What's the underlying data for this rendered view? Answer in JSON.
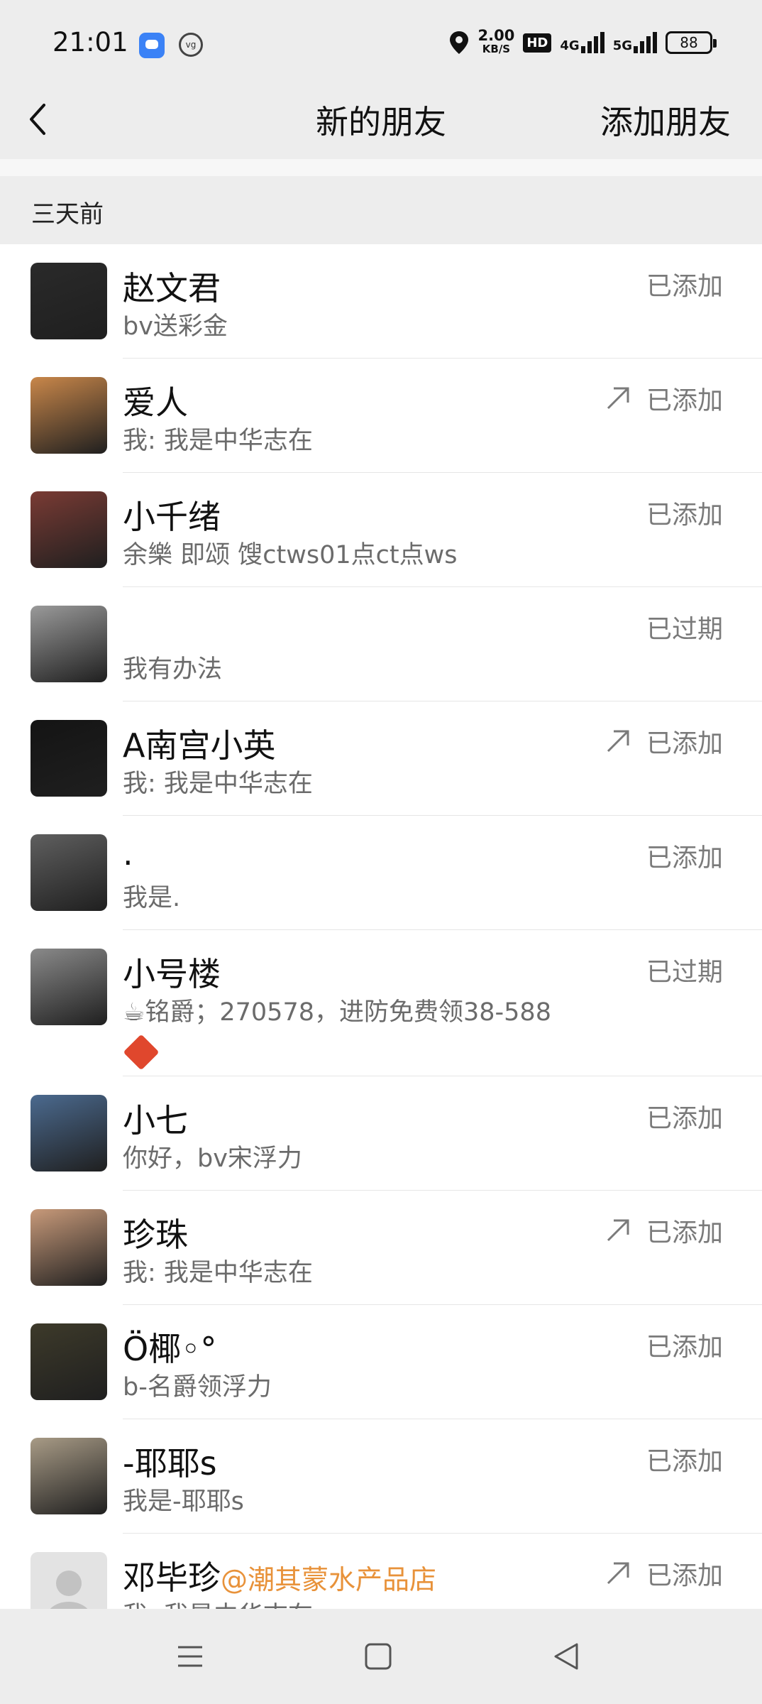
{
  "status_bar": {
    "time": "21:01",
    "speed_value": "2.00",
    "speed_unit": "KB/S",
    "hd_label": "HD",
    "net1": "4G",
    "net2": "5G",
    "battery": "88"
  },
  "header": {
    "back_icon": "chevron-left-icon",
    "title": "新的朋友",
    "add_label": "添加朋友"
  },
  "section": {
    "label": "三天前"
  },
  "friends": [
    {
      "name": "赵文君",
      "message": "bv送彩金",
      "status": "已添加",
      "arrow": false,
      "avatar_color": "#2a2a2a"
    },
    {
      "name": "爱人",
      "message": "我: 我是中华志在",
      "status": "已添加",
      "arrow": true,
      "avatar_color": "#c9874a"
    },
    {
      "name": "小千绪",
      "message": "余樂 即颂 馊ctws01点ct点ws",
      "status": "已添加",
      "arrow": false,
      "avatar_color": "#7a3b34"
    },
    {
      "name": "",
      "message": "我有办法",
      "status": "已过期",
      "arrow": false,
      "avatar_color": "#9a9a9a"
    },
    {
      "name": "A南宫小英",
      "message": "我: 我是中华志在",
      "status": "已添加",
      "arrow": true,
      "avatar_color": "#141414"
    },
    {
      "name": ".",
      "message": "我是.",
      "status": "已添加",
      "arrow": false,
      "avatar_color": "#5f5f5f"
    },
    {
      "name": "小号楼",
      "message": "☕铭爵；270578，进防免费领38-588",
      "status": "已过期",
      "arrow": false,
      "avatar_color": "#8a8a8a",
      "tall": true
    },
    {
      "name": "小七",
      "message": "你好，bv宋浮力",
      "status": "已添加",
      "arrow": false,
      "avatar_color": "#4b6a8f"
    },
    {
      "name": "珍珠",
      "message": "我: 我是中华志在",
      "status": "已添加",
      "arrow": true,
      "avatar_color": "#c89a7a"
    },
    {
      "name": "Ö椰◦°",
      "message": "b-名爵领浮力",
      "status": "已添加",
      "arrow": false,
      "avatar_color": "#3d3a2a"
    },
    {
      "name": "-耶耶s",
      "message": "我是-耶耶s",
      "status": "已添加",
      "arrow": false,
      "avatar_color": "#a89b86"
    },
    {
      "name": "邓毕珍",
      "name_tag": "@潮其蒙水产品店",
      "message": "我: 我是中华志在",
      "status": "已添加",
      "arrow": true,
      "avatar_color": "#d8d8d8"
    }
  ],
  "nav": {
    "menu_icon": "menu-icon",
    "home_icon": "home-square-icon",
    "back_icon": "back-triangle-icon"
  }
}
